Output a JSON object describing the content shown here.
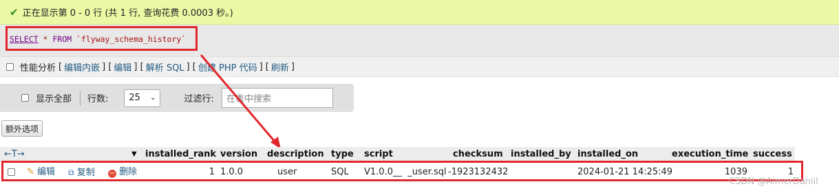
{
  "success_message": "正在显示第 0 - 0 行 (共 1 行, 查询花费 0.0003 秒。)",
  "sql": {
    "select": "SELECT",
    "star": "*",
    "from": "FROM",
    "table": "`flyway_schema_history`"
  },
  "links": {
    "profiling_label": "性能分析",
    "edit_inline": "编辑内嵌",
    "edit": "编辑",
    "explain_sql": "解析 SQL",
    "create_php": "创建 PHP 代码",
    "refresh": "刷新"
  },
  "nav": {
    "show_all_label": "显示全部",
    "rows_label": "行数:",
    "rows_value": "25",
    "filter_label": "过滤行:",
    "search_placeholder": "在表中搜索"
  },
  "extra_options_label": "额外选项",
  "table": {
    "sort_arrows": "←T→",
    "columns": [
      "installed_rank",
      "version",
      "description",
      "type",
      "script",
      "checksum",
      "installed_by",
      "installed_on",
      "execution_time",
      "success"
    ],
    "row": {
      "edit_label": "编辑",
      "copy_label": "复制",
      "delete_label": "删除",
      "installed_rank": "1",
      "version": "1.0.0",
      "description": "user",
      "type": "SQL",
      "script": "V1.0.0__  _user.sql",
      "checksum": "-1923132432",
      "installed_by": "",
      "installed_on": "2024-01-21 14:25:49",
      "execution_time": "1039",
      "success": "1"
    }
  },
  "watermark": "CSDN @AimerDaniil",
  "colors": {
    "highlight_border": "#e0262a",
    "success_bg": "#ebf8a4",
    "link": "#235a81"
  }
}
